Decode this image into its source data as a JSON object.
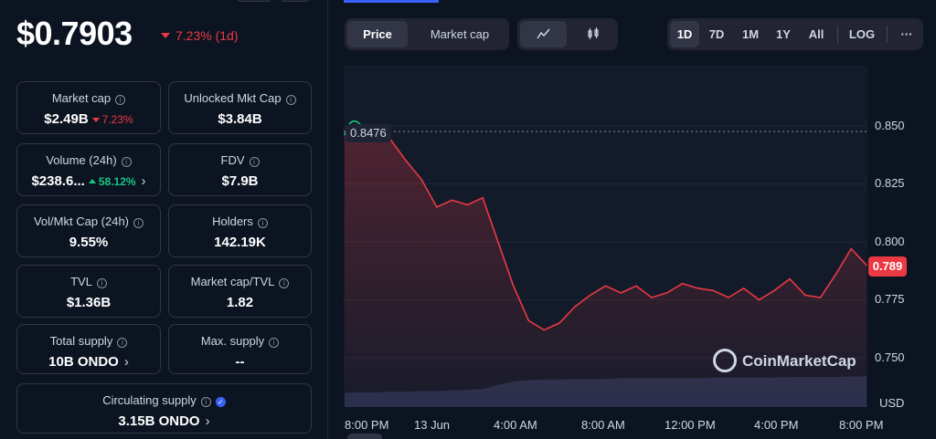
{
  "price": {
    "value": "$0.7903",
    "change": "7.23% (1d)"
  },
  "stats": {
    "market_cap": {
      "label": "Market cap",
      "value": "$2.49B",
      "change": "7.23%"
    },
    "unlocked_mkt_cap": {
      "label": "Unlocked Mkt Cap",
      "value": "$3.84B"
    },
    "volume": {
      "label": "Volume (24h)",
      "value": "$238.6...",
      "change": "58.12%"
    },
    "fdv": {
      "label": "FDV",
      "value": "$7.9B"
    },
    "vol_mkt_cap": {
      "label": "Vol/Mkt Cap (24h)",
      "value": "9.55%"
    },
    "holders": {
      "label": "Holders",
      "value": "142.19K"
    },
    "tvl": {
      "label": "TVL",
      "value": "$1.36B"
    },
    "mcap_tvl": {
      "label": "Market cap/TVL",
      "value": "1.82"
    },
    "total_supply": {
      "label": "Total supply",
      "value": "10B ONDO"
    },
    "max_supply": {
      "label": "Max. supply",
      "value": "--"
    },
    "circ_supply": {
      "label": "Circulating supply",
      "value": "3.15B ONDO"
    }
  },
  "toolbar": {
    "price_tab": "Price",
    "mcap_tab": "Market cap",
    "ranges": [
      "1D",
      "7D",
      "1M",
      "1Y",
      "All"
    ],
    "log": "LOG",
    "more": "···"
  },
  "chart": {
    "high_label": "0.8476",
    "current_label": "0.789",
    "currency": "USD",
    "watermark": "CoinMarketCap",
    "y_ticks": [
      "0.850",
      "0.825",
      "0.800",
      "0.775",
      "0.750"
    ],
    "x_ticks": [
      "8:00 PM",
      "13 Jun",
      "4:00 AM",
      "8:00 AM",
      "12:00 PM",
      "4:00 PM",
      "8:00 PM"
    ]
  },
  "colors": {
    "down": "#ea3943",
    "up": "#16c784",
    "accent": "#3861fb"
  },
  "chart_data": {
    "type": "line",
    "ylabel": "USD",
    "ylim": [
      0.74,
      0.86
    ],
    "x": [
      "8:00 PM",
      "",
      "",
      "",
      "13 Jun",
      "",
      "",
      "",
      "",
      "",
      "4:00 AM",
      "",
      "",
      "",
      "",
      "",
      "8:00 AM",
      "",
      "",
      "",
      "",
      "",
      "12:00 PM",
      "",
      "",
      "",
      "",
      "",
      "4:00 PM",
      "",
      "",
      "",
      "",
      "",
      "8:00 PM"
    ],
    "series": [
      {
        "values": [
          0.8476,
          0.848,
          0.846,
          0.844,
          0.835,
          0.827,
          0.815,
          0.818,
          0.816,
          0.819,
          0.8,
          0.781,
          0.766,
          0.762,
          0.765,
          0.772,
          0.777,
          0.781,
          0.778,
          0.781,
          0.776,
          0.778,
          0.782,
          0.78,
          0.779,
          0.776,
          0.78,
          0.775,
          0.779,
          0.784,
          0.777,
          0.776,
          0.786,
          0.797,
          0.79
        ]
      }
    ]
  }
}
